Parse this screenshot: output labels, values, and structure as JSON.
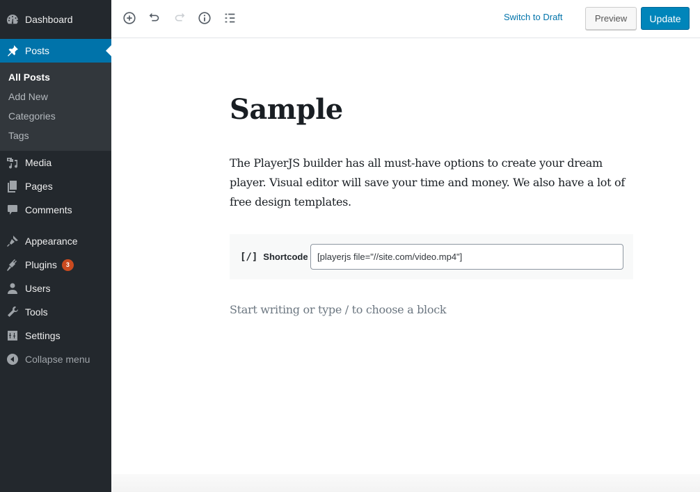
{
  "sidebar": {
    "items": [
      {
        "label": "Dashboard",
        "icon": "dashboard-icon"
      },
      {
        "label": "Posts",
        "icon": "pin-icon",
        "active": true
      },
      {
        "label": "Media",
        "icon": "media-icon"
      },
      {
        "label": "Pages",
        "icon": "pages-icon"
      },
      {
        "label": "Comments",
        "icon": "comment-icon"
      },
      {
        "label": "Appearance",
        "icon": "paintbrush-icon"
      },
      {
        "label": "Plugins",
        "icon": "plugin-icon",
        "badge": "3"
      },
      {
        "label": "Users",
        "icon": "user-icon"
      },
      {
        "label": "Tools",
        "icon": "wrench-icon"
      },
      {
        "label": "Settings",
        "icon": "settings-icon"
      },
      {
        "label": "Collapse menu",
        "icon": "collapse-icon"
      }
    ],
    "submenu": [
      {
        "label": "All Posts",
        "current": true
      },
      {
        "label": "Add New"
      },
      {
        "label": "Categories"
      },
      {
        "label": "Tags"
      }
    ]
  },
  "header": {
    "tools": [
      "add-block-icon",
      "undo-icon",
      "redo-icon",
      "info-icon",
      "outline-icon"
    ],
    "switch_to_draft": "Switch to Draft",
    "preview": "Preview",
    "update": "Update"
  },
  "editor": {
    "title": "Sample",
    "paragraph": "The PlayerJS builder has all must-have options to create your dream player. Visual editor will save your time and money. We also have a lot of free design templates.",
    "shortcode": {
      "icon_text": "[/]",
      "label": "Shortcode",
      "value": "[playerjs file=\"//site.com/video.mp4\"]"
    },
    "placeholder": "Start writing or type / to choose a block"
  },
  "colors": {
    "sidebar_bg": "#23282d",
    "submenu_bg": "#32373c",
    "accent": "#0073aa",
    "update_button": "#0085ba",
    "badge": "#ca4a1f"
  }
}
